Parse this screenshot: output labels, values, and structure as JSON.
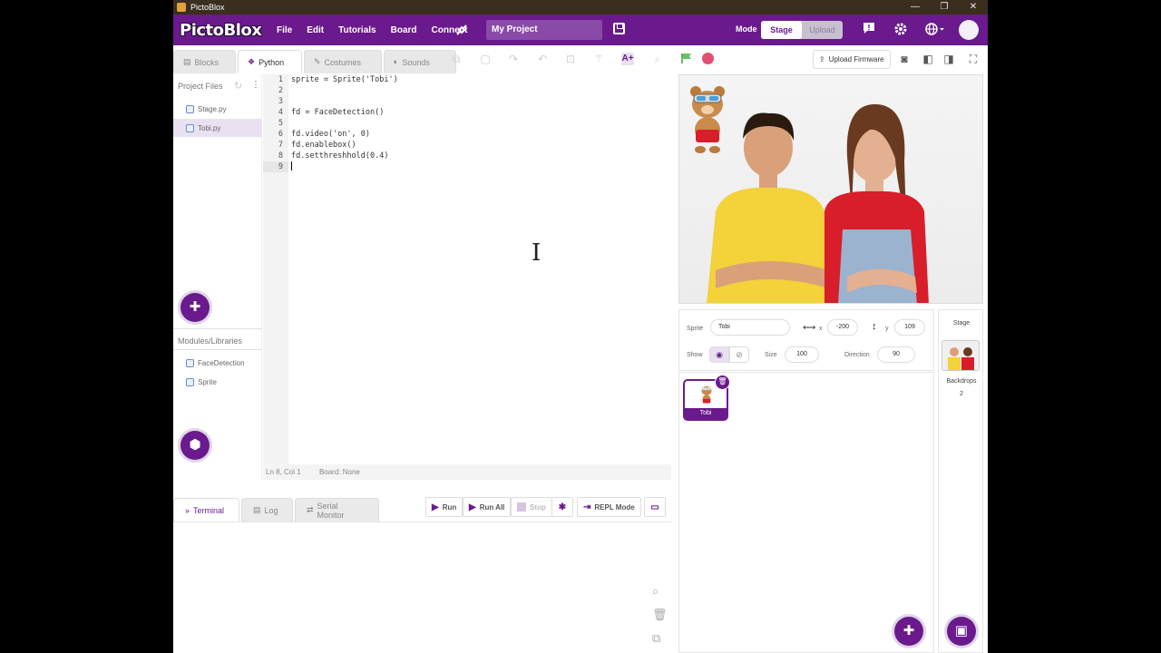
{
  "window": {
    "title": "PictoBlox",
    "minimize": "—",
    "maximize": "❐",
    "close": "✕"
  },
  "menubar": {
    "logo": "PictoBlox",
    "items": [
      "File",
      "Edit",
      "Tutorials",
      "Board",
      "Connect"
    ],
    "project_name": "My Project",
    "mode_label": "Mode",
    "mode_stage": "Stage",
    "mode_upload": "Upload"
  },
  "tabs": {
    "blocks": "Blocks",
    "python": "Python",
    "costumes": "Costumes",
    "sounds": "Sounds"
  },
  "project_files": {
    "header": "Project Files",
    "files": [
      "Stage.py",
      "Tobi.py"
    ],
    "modules_header": "Modules/Libraries",
    "modules": [
      "FaceDetection",
      "Sprite"
    ]
  },
  "editor": {
    "line_numbers": [
      "1",
      "2",
      "3",
      "4",
      "5",
      "6",
      "7",
      "8",
      "9"
    ],
    "lines": [
      "sprite = Sprite('Tobi')",
      "",
      "",
      "fd = FaceDetection()",
      "",
      "fd.video('on', 0)",
      "fd.enablebox()",
      "fd.setthreshhold(0.4)",
      ""
    ],
    "status_pos": "Ln 8, Col 1",
    "status_board": "Board: None"
  },
  "terminal": {
    "tabs": [
      "Terminal",
      "Log",
      "Serial Monitor"
    ],
    "run": "Run",
    "run_all": "Run All",
    "stop": "Stop",
    "repl": "REPL Mode"
  },
  "stage_toolbar": {
    "upload_firmware": "Upload Firmware"
  },
  "sprite_info": {
    "sprite_label": "Sprite",
    "sprite_name": "Tobi",
    "x_label": "x",
    "x": "-200",
    "y_label": "y",
    "y": "109",
    "show_label": "Show",
    "size_label": "Size",
    "size": "100",
    "direction_label": "Direction",
    "direction": "90"
  },
  "sprites": [
    {
      "name": "Tobi"
    }
  ],
  "stage_panel": {
    "title": "Stage",
    "backdrops_label": "Backdrops",
    "backdrops_count": "2"
  },
  "colors": {
    "brand": "#6a1a8c",
    "accent_light": "#e9e1f0"
  }
}
